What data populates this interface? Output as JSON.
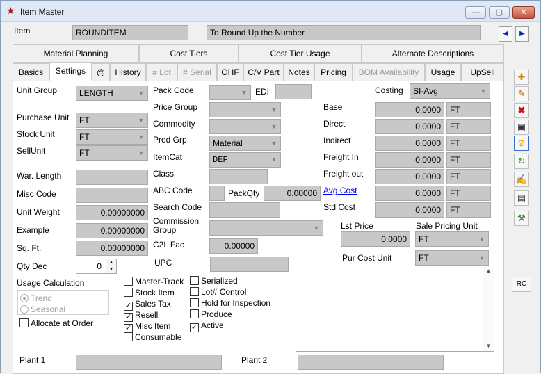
{
  "window": {
    "title": "Item Master"
  },
  "header": {
    "item_label": "Item",
    "item_code": "ROUNDITEM",
    "item_desc": "To Round Up the Number"
  },
  "tabs_row1": [
    "Material Planning",
    "Cost Tiers",
    "Cost Tier Usage",
    "Alternate Descriptions"
  ],
  "tabs_row2": [
    "Basics",
    "Settings",
    "@",
    "History",
    "# Lot",
    "# Serial",
    "OHF",
    "C/V Part",
    "Notes",
    "Pricing",
    "BOM Availability",
    "Usage",
    "UpSell"
  ],
  "left": {
    "unit_group_label": "Unit Group",
    "unit_group": "LENGTH",
    "purchase_unit_label": "Purchase Unit",
    "purchase_unit": "FT",
    "stock_unit_label": "Stock Unit",
    "stock_unit": "FT",
    "sell_unit_label": "SellUnit",
    "sell_unit": "FT",
    "war_length_label": "War. Length",
    "misc_code_label": "Misc Code",
    "unit_weight_label": "Unit Weight",
    "unit_weight": "0.00000000",
    "example_label": "Example",
    "example": "0.00000000",
    "sqft_label": "Sq. Ft.",
    "sqft": "0.00000000",
    "qty_dec_label": "Qty Dec",
    "qty_dec": "0"
  },
  "usage_calc": {
    "label": "Usage Calculation",
    "trend": "Trend",
    "seasonal": "Seasonal",
    "allocate": "Allocate at Order"
  },
  "middle": {
    "pack_code_label": "Pack Code",
    "edi_label": "EDI",
    "price_group_label": "Price Group",
    "commodity_label": "Commodity",
    "prod_grp_label": "Prod Grp",
    "prod_grp": "Material",
    "itemcat_label": "ItemCat",
    "itemcat": "DEF",
    "class_label": "Class",
    "abc_code_label": "ABC Code",
    "packqty_label": "PackQty",
    "packqty": "0.00000",
    "search_code_label": "Search Code",
    "commission_group_label": "Commission Group",
    "c2l_fac_label": "C2L Fac",
    "c2l_fac": "0.00000",
    "upc_label": "UPC"
  },
  "costs": {
    "costing_label": "Costing",
    "costing": "SI-Avg",
    "rows": [
      {
        "label": "Base",
        "value": "0.0000",
        "unit": "FT"
      },
      {
        "label": "Direct",
        "value": "0.0000",
        "unit": "FT"
      },
      {
        "label": "Indirect",
        "value": "0.0000",
        "unit": "FT"
      },
      {
        "label": "Freight In",
        "value": "0.0000",
        "unit": "FT"
      },
      {
        "label": "Freight out",
        "value": "0.0000",
        "unit": "FT"
      },
      {
        "label": "Avg Cost",
        "value": "0.0000",
        "unit": "FT"
      },
      {
        "label": "Std Cost",
        "value": "0.0000",
        "unit": "FT"
      }
    ],
    "lst_price_label": "Lst Price",
    "lst_price": "0.0000",
    "sale_pricing_unit_label": "Sale Pricing Unit",
    "sale_pricing_unit": "FT",
    "pur_cost_unit_label": "Pur Cost Unit",
    "pur_cost_unit": "FT"
  },
  "checks_col1": [
    {
      "label": "Master-Track",
      "checked": false
    },
    {
      "label": "Stock Item",
      "checked": false
    },
    {
      "label": "Sales Tax",
      "checked": true
    },
    {
      "label": "Resell",
      "checked": true
    },
    {
      "label": "Misc Item",
      "checked": true
    },
    {
      "label": "Consumable",
      "checked": false
    }
  ],
  "checks_col2": [
    {
      "label": "Serialized",
      "checked": false
    },
    {
      "label": "Lot# Control",
      "checked": false
    },
    {
      "label": "Hold for Inspection",
      "checked": false
    },
    {
      "label": "Produce",
      "checked": false
    },
    {
      "label": "Active",
      "checked": true
    }
  ],
  "plants": {
    "plant1_label": "Plant 1",
    "plant2_label": "Plant 2"
  },
  "sidebar": {
    "rc_label": "RC"
  }
}
